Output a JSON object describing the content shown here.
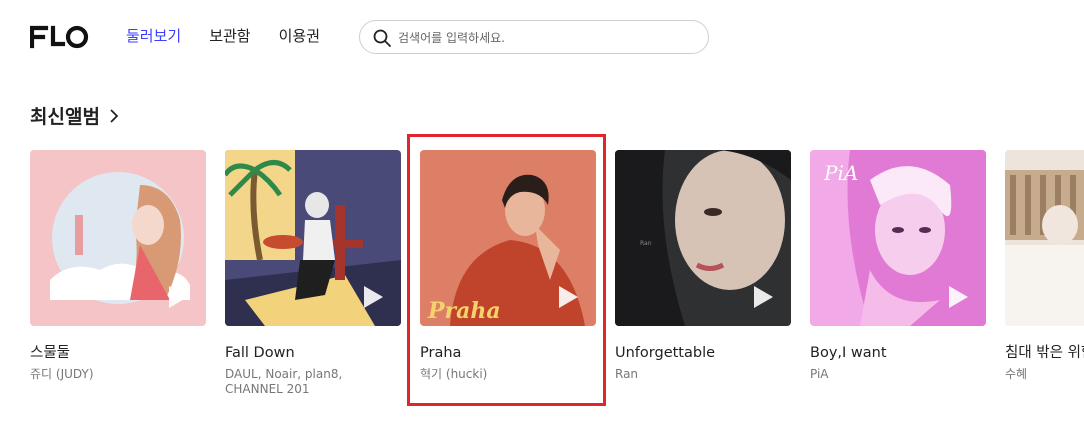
{
  "header": {
    "logo_text": "FLO",
    "nav": [
      {
        "label": "둘러보기",
        "active": true
      },
      {
        "label": "보관함",
        "active": false
      },
      {
        "label": "이용권",
        "active": false
      }
    ],
    "search": {
      "placeholder": "검색어를 입력하세요.",
      "icon": "search-icon"
    }
  },
  "section": {
    "title": "최신앨범",
    "icon": "chevron-right-icon"
  },
  "albums": [
    {
      "title": "스물둘",
      "artist": "쥬디 (JUDY)"
    },
    {
      "title": "Fall Down",
      "artist": "DAUL, Noair, plan8, CHANNEL 201"
    },
    {
      "title": "Praha",
      "artist": "혁기 (hucki)",
      "cover_text": "Praha",
      "highlighted": true
    },
    {
      "title": "Unforgettable",
      "artist": "Ran"
    },
    {
      "title": "Boy,I want",
      "artist": "PiA",
      "cover_text": "PiA"
    },
    {
      "title": "침대 밖은 위험해",
      "artist": "수혜"
    }
  ],
  "colors": {
    "accent": "#3f3fff",
    "highlight": "#e0262c"
  }
}
